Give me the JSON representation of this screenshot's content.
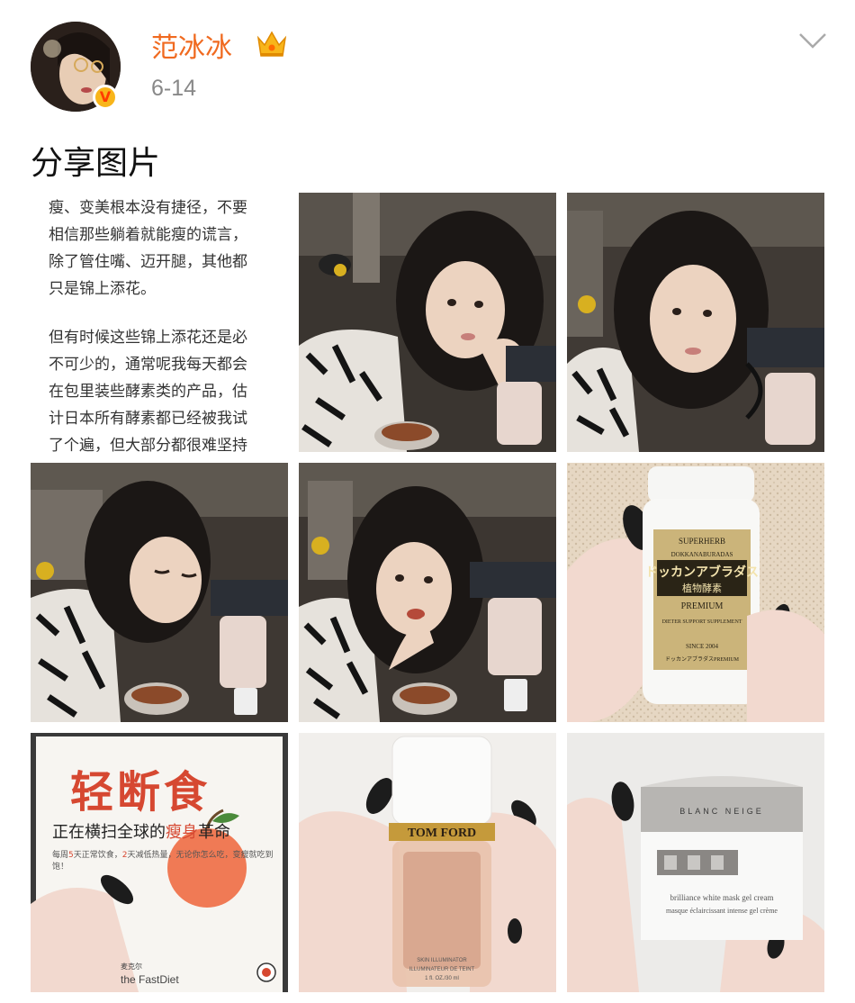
{
  "post": {
    "username": "范冰冰",
    "date": "6-14",
    "title": "分享图片"
  },
  "text_card": {
    "paragraph1": [
      "瘦、变美根本没有捷径，不要",
      "相信那些躺着就能瘦的谎言，",
      "除了管住嘴、迈开腿，其他都",
      "只是锦上添花。"
    ],
    "paragraph2": [
      "但有时候这些锦上添花还是必",
      "不可少的，通常呢我每天都会",
      "在包里装些酵素类的产品，估",
      "计日本所有酵素都已经被我试",
      "了个遍，但大部分都很难坚持"
    ]
  },
  "product_bottle": {
    "brand": "SUPERHERB",
    "arc_text": "DOKKANABURADAS",
    "name_jp": "ドッカンアブラダス",
    "name_cn": "植物酵素",
    "grade": "PREMIUM",
    "tagline": "DIETER SUPPORT SUPPLEMENT",
    "since": "SINCE 2004",
    "bottom_line": "ドッカンアブラダスPREMIUM"
  },
  "book": {
    "title": "轻断食",
    "subtitle_pre": "正在横扫全球的",
    "subtitle_highlight": "瘦身",
    "subtitle_post": "革命",
    "tagline_pre": "每周",
    "tagline_num1": "5",
    "tagline_mid1": "天正常饮食，",
    "tagline_num2": "2",
    "tagline_mid2": "天减低热量，",
    "tagline_post": "无论你怎么吃，变瘦就吃到饱！",
    "author": "the FastDiet",
    "author_small": "麦克尔"
  },
  "foundation_bottle": {
    "brand": "TOM FORD",
    "line1": "SKIN ILLUMINATOR",
    "line2": "ILLUMINATEUR DE TEINT",
    "line3": "1 fl. OZ./30 ml"
  },
  "cream_jar": {
    "rim_text": "BLANC NEIGE",
    "line1": "brilliance white mask gel cream",
    "line2": "masque éclaircissant intense gel crème"
  },
  "colors": {
    "username": "#f06a20",
    "crown": "#f8b51a",
    "verified_badge": "#f8b51a",
    "date": "#888888",
    "book_red": "#d64831"
  },
  "icons": [
    "verified-badge-icon",
    "crown-icon",
    "chevron-down-icon"
  ]
}
